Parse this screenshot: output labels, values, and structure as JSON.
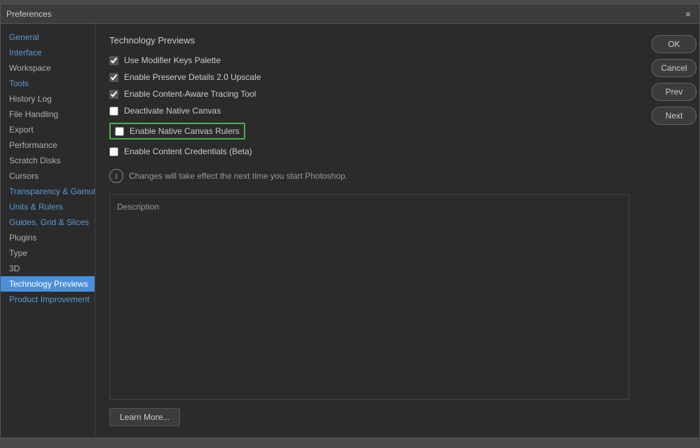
{
  "window": {
    "title": "Preferences",
    "close_label": "×"
  },
  "sidebar": {
    "items": [
      {
        "label": "General",
        "id": "general",
        "highlight": true,
        "active": false
      },
      {
        "label": "Interface",
        "id": "interface",
        "highlight": true,
        "active": false
      },
      {
        "label": "Workspace",
        "id": "workspace",
        "highlight": false,
        "active": false
      },
      {
        "label": "Tools",
        "id": "tools",
        "highlight": true,
        "active": false
      },
      {
        "label": "History Log",
        "id": "history-log",
        "highlight": false,
        "active": false
      },
      {
        "label": "File Handling",
        "id": "file-handling",
        "highlight": false,
        "active": false
      },
      {
        "label": "Export",
        "id": "export",
        "highlight": false,
        "active": false
      },
      {
        "label": "Performance",
        "id": "performance",
        "highlight": false,
        "active": false
      },
      {
        "label": "Scratch Disks",
        "id": "scratch-disks",
        "highlight": false,
        "active": false
      },
      {
        "label": "Cursors",
        "id": "cursors",
        "highlight": false,
        "active": false
      },
      {
        "label": "Transparency & Gamut",
        "id": "transparency-gamut",
        "highlight": true,
        "active": false
      },
      {
        "label": "Units & Rulers",
        "id": "units-rulers",
        "highlight": true,
        "active": false
      },
      {
        "label": "Guides, Grid & Slices",
        "id": "guides-grid-slices",
        "highlight": true,
        "active": false
      },
      {
        "label": "Plugins",
        "id": "plugins",
        "highlight": false,
        "active": false
      },
      {
        "label": "Type",
        "id": "type",
        "highlight": false,
        "active": false
      },
      {
        "label": "3D",
        "id": "3d",
        "highlight": false,
        "active": false
      },
      {
        "label": "Technology Previews",
        "id": "technology-previews",
        "highlight": false,
        "active": true
      },
      {
        "label": "Product Improvement",
        "id": "product-improvement",
        "highlight": true,
        "active": false
      }
    ]
  },
  "main": {
    "section_title": "Technology Previews",
    "checkboxes": [
      {
        "label": "Use Modifier Keys Palette",
        "checked": true,
        "highlighted": false,
        "id": "modifier-keys"
      },
      {
        "label": "Enable Preserve Details 2.0 Upscale",
        "checked": true,
        "highlighted": false,
        "id": "preserve-details"
      },
      {
        "label": "Enable Content-Aware Tracing Tool",
        "checked": true,
        "highlighted": false,
        "id": "content-aware-tracing"
      },
      {
        "label": "Deactivate Native Canvas",
        "checked": false,
        "highlighted": false,
        "id": "deactivate-native"
      },
      {
        "label": "Enable Native Canvas Rulers",
        "checked": false,
        "highlighted": true,
        "id": "native-canvas-rulers"
      },
      {
        "label": "Enable Content Credentials (Beta)",
        "checked": false,
        "highlighted": false,
        "id": "content-credentials"
      }
    ],
    "info_text": "Changes will take effect the next time you start Photoshop.",
    "description_label": "Description",
    "learn_more_label": "Learn More..."
  },
  "buttons": {
    "ok": "OK",
    "cancel": "Cancel",
    "prev": "Prev",
    "next": "Next"
  }
}
